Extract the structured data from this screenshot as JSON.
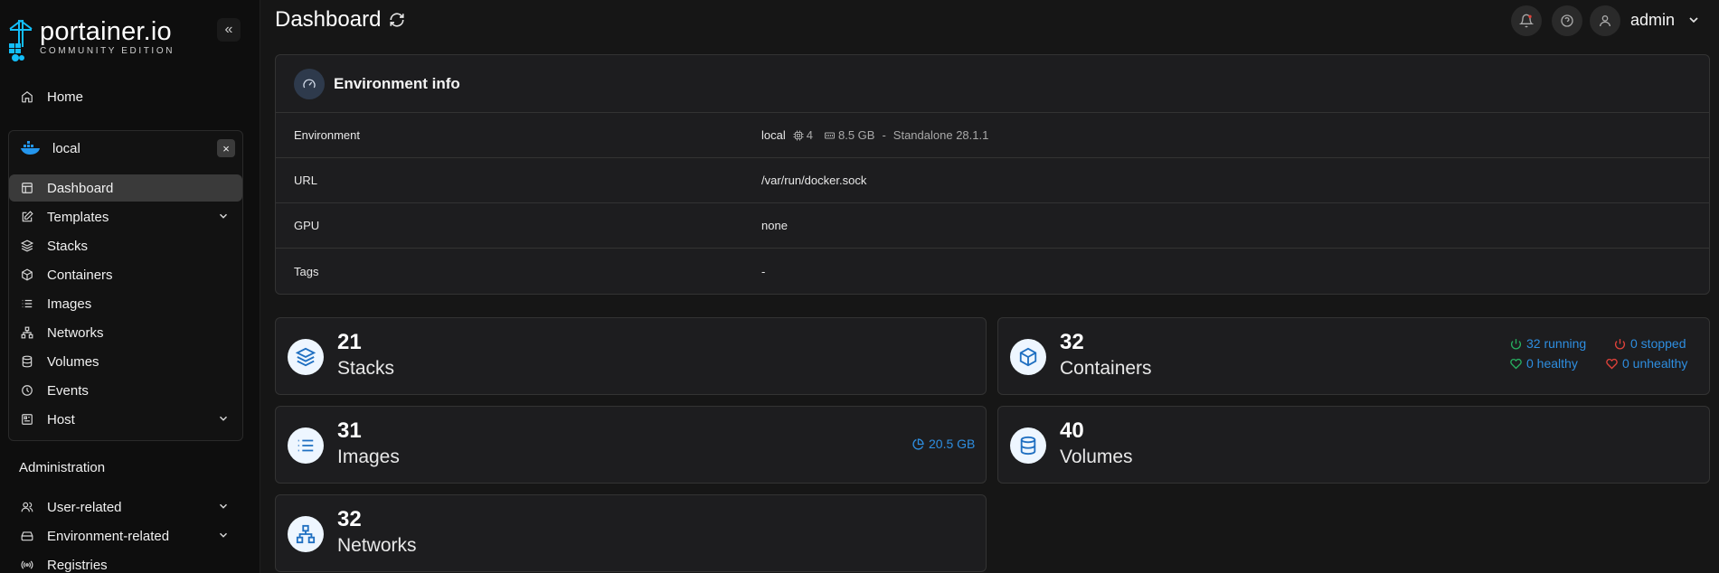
{
  "brand": {
    "logo_main": "portainer.io",
    "logo_sub": "COMMUNITY EDITION",
    "collapse_glyph": "«"
  },
  "sidebar": {
    "home_label": "Home",
    "env_name": "local",
    "env_close_glyph": "×",
    "items": [
      {
        "label": "Dashboard",
        "icon": "dashboard-icon"
      },
      {
        "label": "Templates",
        "icon": "edit-icon"
      },
      {
        "label": "Stacks",
        "icon": "layers-icon"
      },
      {
        "label": "Containers",
        "icon": "box-icon"
      },
      {
        "label": "Images",
        "icon": "list-icon"
      },
      {
        "label": "Networks",
        "icon": "network-icon"
      },
      {
        "label": "Volumes",
        "icon": "database-icon"
      },
      {
        "label": "Events",
        "icon": "clock-icon"
      },
      {
        "label": "Host",
        "icon": "host-icon"
      }
    ],
    "admin_section_title": "Administration",
    "admin_items": [
      {
        "label": "User-related",
        "icon": "users-icon"
      },
      {
        "label": "Environment-related",
        "icon": "hdd-icon"
      },
      {
        "label": "Registries",
        "icon": "radio-icon"
      }
    ]
  },
  "header": {
    "title": "Dashboard",
    "user": "admin"
  },
  "env_info": {
    "title": "Environment info",
    "rows": [
      {
        "key": "Environment",
        "value": "local"
      },
      {
        "key": "URL",
        "value": "/var/run/docker.sock"
      },
      {
        "key": "GPU",
        "value": "none"
      },
      {
        "key": "Tags",
        "value": "-"
      }
    ],
    "cpu": "4",
    "memory": "8.5 GB",
    "separator": "-",
    "engine": "Standalone 28.1.1"
  },
  "stats": {
    "stacks": {
      "count": "21",
      "label": "Stacks"
    },
    "containers": {
      "count": "32",
      "label": "Containers",
      "running": "32 running",
      "stopped": "0 stopped",
      "healthy": "0 healthy",
      "unhealthy": "0 unhealthy"
    },
    "images": {
      "count": "31",
      "label": "Images",
      "size": "20.5 GB"
    },
    "volumes": {
      "count": "40",
      "label": "Volumes"
    },
    "networks": {
      "count": "32",
      "label": "Networks"
    }
  },
  "colors": {
    "accent_blue": "#2e8ee0",
    "running_green": "#27ae60",
    "stopped_red": "#e0423a"
  }
}
